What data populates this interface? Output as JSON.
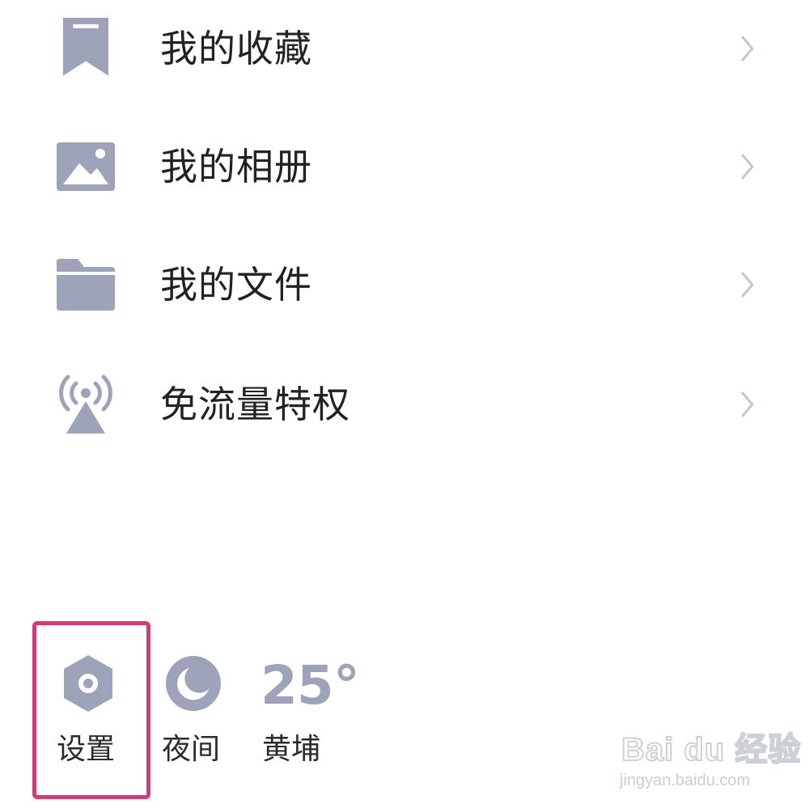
{
  "menu": {
    "items": [
      {
        "label": "我的收藏",
        "icon": "bookmark-icon"
      },
      {
        "label": "我的相册",
        "icon": "photo-icon"
      },
      {
        "label": "我的文件",
        "icon": "folder-icon"
      },
      {
        "label": "免流量特权",
        "icon": "signal-tower-icon"
      }
    ]
  },
  "toolbar": {
    "settings_label": "设置",
    "night_label": "夜间",
    "weather_temp": "25°",
    "weather_location": "黄埔"
  },
  "watermark": {
    "brand": "Bai du 经验",
    "url": "jingyan.baidu.com"
  },
  "colors": {
    "icon": "#9da3b8",
    "chevron": "#c3c6cf",
    "text": "#222222",
    "highlight": "#d63a76"
  }
}
